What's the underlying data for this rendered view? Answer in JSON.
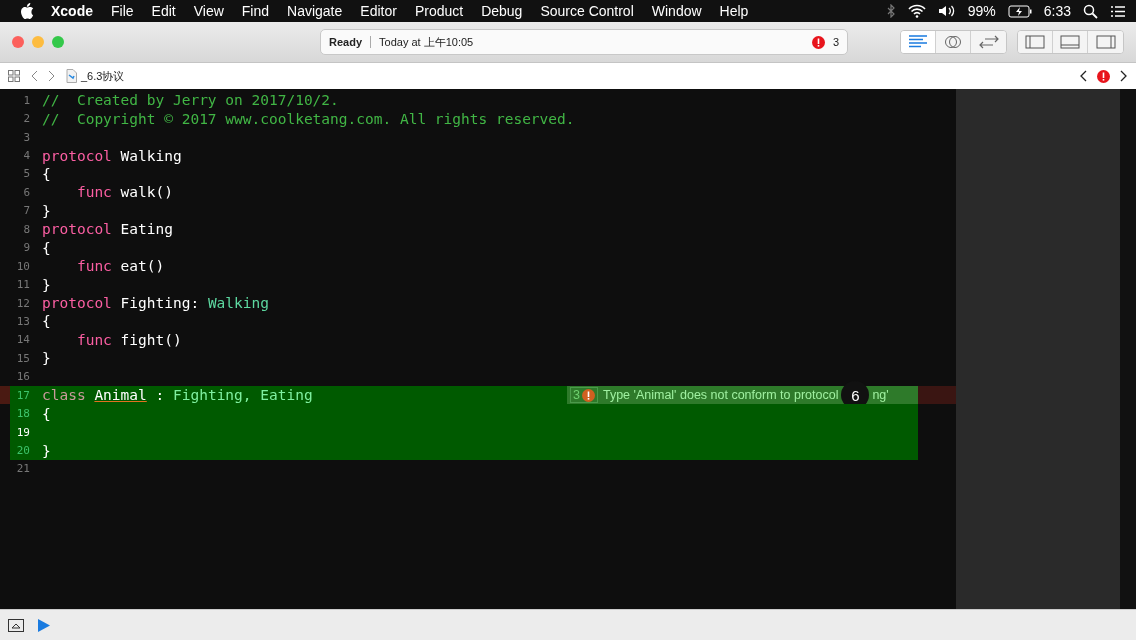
{
  "menu_bar": {
    "app": "Xcode",
    "items": [
      "File",
      "Edit",
      "View",
      "Find",
      "Navigate",
      "Editor",
      "Product",
      "Debug",
      "Source Control",
      "Window",
      "Help"
    ],
    "battery": "99%",
    "time": "6:33"
  },
  "toolbar": {
    "status": "Ready",
    "timestamp": "Today at 上午10:05",
    "error_count": "3",
    "editor_modes": [
      {
        "selected": true
      },
      {
        "selected": false
      },
      {
        "selected": false
      }
    ]
  },
  "jump_bar": {
    "file": "_6.3协议"
  },
  "code": [
    {
      "number": "1",
      "current": false,
      "highlighted": false,
      "tokens": [
        {
          "kind": "comment",
          "text": "//  Created by Jerry on 2017/10/2."
        }
      ]
    },
    {
      "number": "2",
      "current": false,
      "highlighted": false,
      "tokens": [
        {
          "kind": "comment",
          "text": "//  Copyright © 2017 www.coolketang.com. All rights reserved."
        }
      ]
    },
    {
      "number": "3",
      "current": false,
      "highlighted": false
    },
    {
      "number": "4",
      "current": false,
      "highlighted": false,
      "tokens": [
        {
          "kind": "keyword",
          "text": "protocol"
        },
        {
          "kind": "plain",
          "text": " Walking"
        }
      ]
    },
    {
      "number": "5",
      "current": false,
      "highlighted": false,
      "tokens": [
        {
          "kind": "plain",
          "text": "{"
        }
      ]
    },
    {
      "number": "6",
      "current": false,
      "highlighted": false,
      "tokens": [
        {
          "kind": "keyword",
          "text": "    func"
        },
        {
          "kind": "plain",
          "text": " walk()"
        }
      ]
    },
    {
      "number": "7",
      "current": false,
      "highlighted": false,
      "tokens": [
        {
          "kind": "plain",
          "text": "}"
        }
      ]
    },
    {
      "number": "8",
      "current": false,
      "highlighted": false,
      "tokens": [
        {
          "kind": "keyword",
          "text": "protocol"
        },
        {
          "kind": "plain",
          "text": " Eating"
        }
      ]
    },
    {
      "number": "9",
      "current": false,
      "highlighted": false,
      "tokens": [
        {
          "kind": "plain",
          "text": "{"
        }
      ]
    },
    {
      "number": "10",
      "current": false,
      "highlighted": false,
      "tokens": [
        {
          "kind": "keyword",
          "text": "    func"
        },
        {
          "kind": "plain",
          "text": " eat()"
        }
      ]
    },
    {
      "number": "11",
      "current": false,
      "highlighted": false,
      "tokens": [
        {
          "kind": "plain",
          "text": "}"
        }
      ]
    },
    {
      "number": "12",
      "current": false,
      "highlighted": false,
      "tokens": [
        {
          "kind": "keyword",
          "text": "protocol"
        },
        {
          "kind": "plain",
          "text": " Fighting: "
        },
        {
          "kind": "type",
          "text": "Walking"
        }
      ]
    },
    {
      "number": "13",
      "current": false,
      "highlighted": false,
      "tokens": [
        {
          "kind": "plain",
          "text": "{"
        }
      ]
    },
    {
      "number": "14",
      "current": false,
      "highlighted": false,
      "tokens": [
        {
          "kind": "keyword",
          "text": "    func"
        },
        {
          "kind": "plain",
          "text": " fight()"
        }
      ]
    },
    {
      "number": "15",
      "current": false,
      "highlighted": false,
      "tokens": [
        {
          "kind": "plain",
          "text": "}"
        }
      ]
    },
    {
      "number": "16",
      "current": false,
      "highlighted": false
    },
    {
      "number": "17",
      "current": false,
      "highlighted": true,
      "error": {
        "count": "3",
        "before": "Type 'Animal' does not conform to protocol",
        "step": "6",
        "after": "ng'"
      },
      "tokens": [
        {
          "kind": "keyword",
          "text": "class "
        },
        {
          "kind": "flagged",
          "text": "Animal"
        },
        {
          "kind": "plain",
          "text": " : "
        },
        {
          "kind": "type",
          "text": "Fighting, Eating"
        }
      ]
    },
    {
      "number": "18",
      "current": false,
      "highlighted": true,
      "tokens": [
        {
          "kind": "plain",
          "text": "{"
        }
      ]
    },
    {
      "number": "19",
      "current": true,
      "highlighted": true
    },
    {
      "number": "20",
      "current": false,
      "highlighted": true,
      "tokens": [
        {
          "kind": "plain",
          "text": "}"
        }
      ]
    },
    {
      "number": "21",
      "current": false,
      "highlighted": false
    }
  ]
}
